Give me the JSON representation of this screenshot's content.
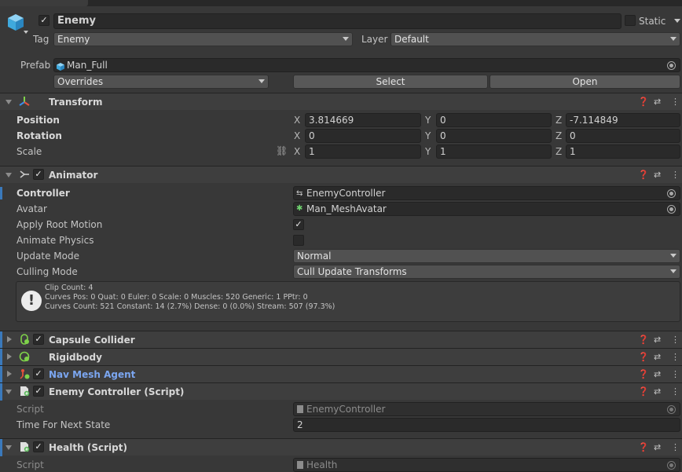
{
  "inspector_tab": "Inspector",
  "gameobject": {
    "name": "Enemy",
    "static_label": "Static",
    "tag_label": "Tag",
    "tag_value": "Enemy",
    "layer_label": "Layer",
    "layer_value": "Default",
    "prefab_label": "Prefab",
    "prefab_value": "Man_Full",
    "overrides_label": "Overrides",
    "select_label": "Select",
    "open_label": "Open"
  },
  "transform": {
    "title": "Transform",
    "position_label": "Position",
    "rotation_label": "Rotation",
    "scale_label": "Scale",
    "position": {
      "x": "3.814669",
      "y": "0",
      "z": "-7.114849"
    },
    "rotation": {
      "x": "0",
      "y": "0",
      "z": "0"
    },
    "scale": {
      "x": "1",
      "y": "1",
      "z": "1"
    },
    "axis_x": "X",
    "axis_y": "Y",
    "axis_z": "Z"
  },
  "animator": {
    "title": "Animator",
    "controller_label": "Controller",
    "controller_value": "EnemyController",
    "avatar_label": "Avatar",
    "avatar_value": "Man_MeshAvatar",
    "apply_root_motion_label": "Apply Root Motion",
    "apply_root_motion": true,
    "animate_physics_label": "Animate Physics",
    "animate_physics": false,
    "update_mode_label": "Update Mode",
    "update_mode_value": "Normal",
    "culling_mode_label": "Culling Mode",
    "culling_mode_value": "Cull Update Transforms",
    "info_line1": "Clip Count: 4",
    "info_line2": "Curves Pos: 0 Quat: 0 Euler: 0 Scale: 0 Muscles: 520 Generic: 1 PPtr: 0",
    "info_line3": "Curves Count: 521 Constant: 14 (2.7%) Dense: 0 (0.0%) Stream: 507 (97.3%)"
  },
  "components": {
    "capsule_collider": "Capsule Collider",
    "rigidbody": "Rigidbody",
    "nav_mesh_agent": "Nav Mesh Agent",
    "enemy_controller": "Enemy Controller (Script)",
    "health": "Health (Script)"
  },
  "enemy_controller": {
    "script_label": "Script",
    "script_value": "EnemyController",
    "time_label": "Time For Next State",
    "time_value": "2"
  },
  "health": {
    "script_label": "Script",
    "script_value": "Health"
  },
  "colors": {
    "background": "#383838",
    "accent_blue": "#3a79bb",
    "link_blue": "#7ba6f0"
  }
}
